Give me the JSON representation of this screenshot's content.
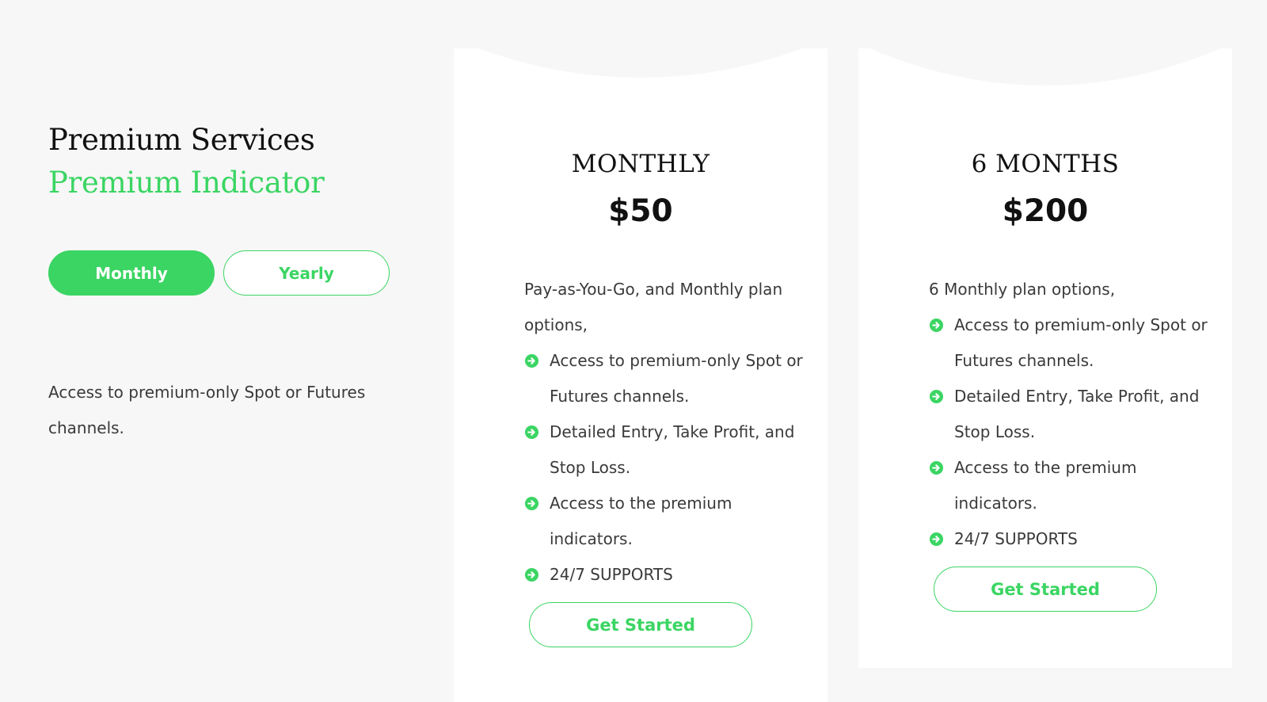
{
  "colors": {
    "accent": "#3bd563",
    "background": "#f7f7f7",
    "card": "#ffffff",
    "heading": "#111111",
    "body_text": "#3a3a3a"
  },
  "intro": {
    "title_prefix": "Premium Services",
    "title_accent": "Premium Indicator",
    "description": "Access to premium-only Spot or Futures channels."
  },
  "billing_toggle": {
    "monthly_label": "Monthly",
    "yearly_label": "Yearly",
    "selected": "Monthly"
  },
  "plans": [
    {
      "name": "MONTHLY",
      "price": "$50",
      "intro": "Pay-as-You-Go, and Monthly plan options,",
      "features": [
        "Access to premium-only Spot or Futures channels.",
        "Detailed Entry, Take Profit, and Stop Loss.",
        "Access to the premium indicators.",
        "24/7 SUPPORTS"
      ],
      "feature_icon": "arrow-circle-right-icon",
      "cta_label": "Get Started"
    },
    {
      "name": "6 MONTHS",
      "price": "$200",
      "intro": "6 Monthly plan options,",
      "features": [
        "Access to premium-only Spot or Futures channels.",
        "Detailed Entry, Take Profit, and Stop Loss.",
        "Access to the premium indicators.",
        "24/7 SUPPORTS"
      ],
      "feature_icon": "arrow-circle-right-icon",
      "cta_label": "Get Started"
    }
  ]
}
